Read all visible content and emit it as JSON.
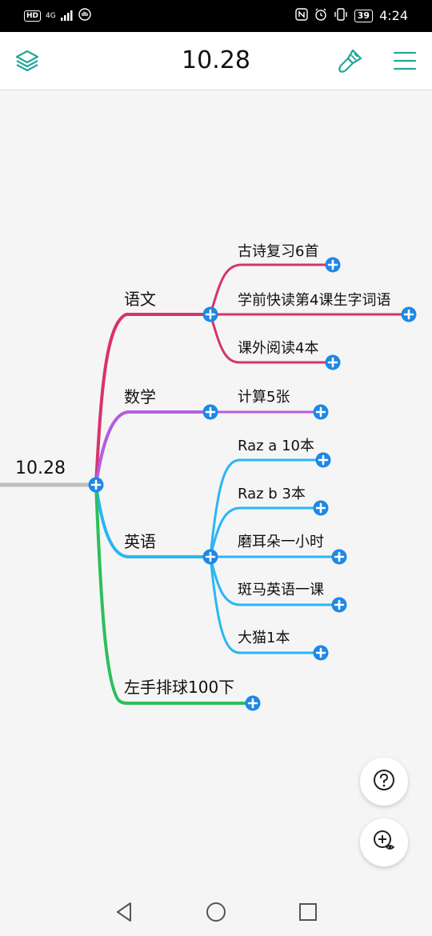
{
  "status_bar": {
    "left_badge": "HD",
    "network": "4G",
    "battery": "39",
    "time": "4:24"
  },
  "app_bar": {
    "title": "10.28",
    "left_icon": "layers-icon",
    "right_icons": [
      "brush-icon",
      "menu-icon"
    ],
    "accent_color": "#26a69a"
  },
  "mindmap": {
    "root": {
      "label": "10.28"
    },
    "branches": [
      {
        "label": "语文",
        "color": "#d6336c",
        "children": [
          "古诗复习6首",
          "学前快读第4课生字词语",
          "课外阅读4本"
        ]
      },
      {
        "label": "数学",
        "color": "#b15ee0",
        "children": [
          "计算5张"
        ]
      },
      {
        "label": "英语",
        "color": "#29b6f6",
        "children": [
          "Raz a 10本",
          "Raz b 3本",
          "磨耳朵一小时",
          "斑马英语一课",
          "大猫1本"
        ]
      },
      {
        "label": "左手排球100下",
        "color": "#2dbe5a",
        "children": []
      }
    ],
    "add_button_color": "#1e88e5"
  },
  "fabs": {
    "help": "help-icon",
    "zoom_view": "zoom-view-icon"
  },
  "nav_bar": [
    "back-icon",
    "home-icon",
    "recents-icon"
  ]
}
